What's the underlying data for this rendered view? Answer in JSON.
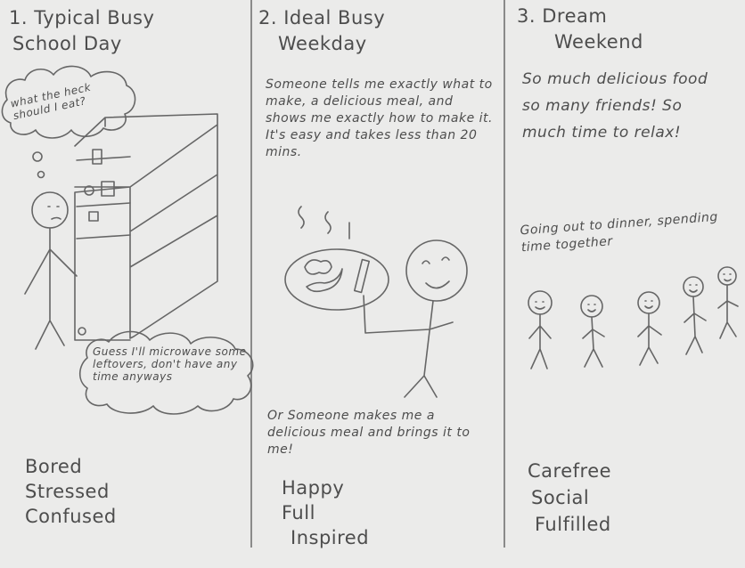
{
  "panels": [
    {
      "number": "1.",
      "title_line1": "Typical Busy",
      "title_line2": "School Day",
      "thought_top": "what the heck should I eat?",
      "thought_bottom": "Guess I'll microwave some leftovers, don't have any time anyways",
      "feelings": [
        "Bored",
        "Stressed",
        "Confused"
      ]
    },
    {
      "number": "2.",
      "title_line1": "Ideal Busy",
      "title_line2": "Weekday",
      "text_top": "Someone tells me exactly what to make, a delicious meal, and shows me exactly how to make it. It's easy and takes less than 20 mins.",
      "text_bottom": "Or Someone makes me a delicious meal and brings it to me!",
      "feelings": [
        "Happy",
        "Full",
        "Inspired"
      ]
    },
    {
      "number": "3.",
      "title_line1": "Dream",
      "title_line2": "Weekend",
      "text_top": "So much delicious food so many friends! So much time to relax!",
      "caption": "Going out to dinner, spending time together",
      "feelings": [
        "Carefree",
        "Social",
        "Fulfilled"
      ]
    }
  ]
}
